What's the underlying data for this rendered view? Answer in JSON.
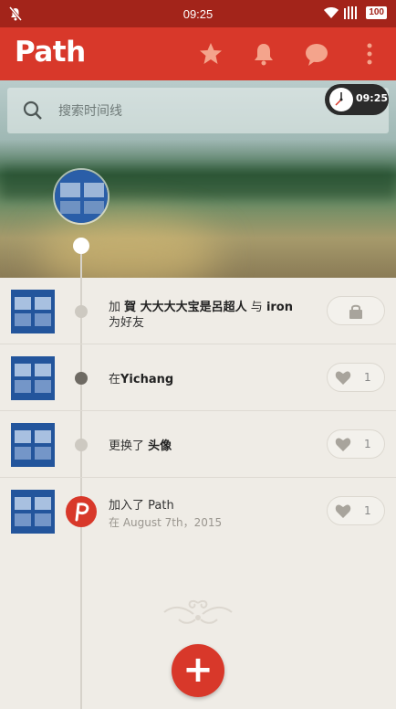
{
  "status_bar": {
    "time": "09:25",
    "battery": "100"
  },
  "app_bar": {
    "logo": "Path"
  },
  "search": {
    "placeholder": "搜索时间线"
  },
  "clock_badge": {
    "time": "09:25"
  },
  "timeline": [
    {
      "prefix": "加 ",
      "strong1": "賀 大大大大宝是呂超人",
      "mid": " 与 ",
      "strong2": "iron",
      "suffix": " 　为好友",
      "action": "lock"
    },
    {
      "prefix": "在",
      "strong1": "Yichang",
      "mid": "",
      "strong2": "",
      "suffix": "",
      "action": "like",
      "likes": "1"
    },
    {
      "prefix": "更换了 ",
      "strong1": "头像",
      "mid": "",
      "strong2": "",
      "suffix": "",
      "action": "like",
      "likes": "1"
    },
    {
      "prefix": "加入了 Path",
      "strong1": "",
      "mid": "",
      "strong2": "",
      "suffix": "",
      "sub": "在 August 7th，2015",
      "action": "like",
      "likes": "1"
    }
  ],
  "fab": {
    "label": "+"
  },
  "colors": {
    "brand_red": "#d8382a",
    "status_red": "#a3241a",
    "background": "#efece6"
  },
  "icons": [
    "mute-icon",
    "wifi-icon",
    "signal-icon",
    "star-icon",
    "bell-icon",
    "chat-bubble-icon",
    "overflow-menu-icon",
    "search-icon",
    "clock-icon",
    "lock-icon",
    "heart-icon",
    "path-logo-icon",
    "plus-icon",
    "flourish-ornament"
  ]
}
